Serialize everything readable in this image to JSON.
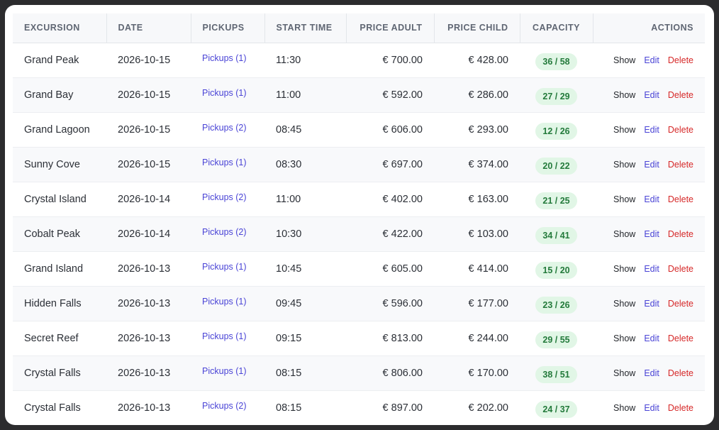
{
  "table": {
    "headers": [
      "Excursion",
      "Date",
      "Pickups",
      "Start Time",
      "Price Adult",
      "Price Child",
      "Capacity",
      "Actions"
    ],
    "action_labels": {
      "show": "Show",
      "edit": "Edit",
      "delete": "Delete"
    },
    "rows": [
      {
        "excursion": "Grand Peak",
        "date": "2026-10-15",
        "pickups": "Pickups (1)",
        "start": "11:30",
        "adult": "€ 700.00",
        "child": "€ 428.00",
        "capacity": "36 / 58"
      },
      {
        "excursion": "Grand Bay",
        "date": "2026-10-15",
        "pickups": "Pickups (1)",
        "start": "11:00",
        "adult": "€ 592.00",
        "child": "€ 286.00",
        "capacity": "27 / 29"
      },
      {
        "excursion": "Grand Lagoon",
        "date": "2026-10-15",
        "pickups": "Pickups (2)",
        "start": "08:45",
        "adult": "€ 606.00",
        "child": "€ 293.00",
        "capacity": "12 / 26"
      },
      {
        "excursion": "Sunny Cove",
        "date": "2026-10-15",
        "pickups": "Pickups (1)",
        "start": "08:30",
        "adult": "€ 697.00",
        "child": "€ 374.00",
        "capacity": "20 / 22"
      },
      {
        "excursion": "Crystal Island",
        "date": "2026-10-14",
        "pickups": "Pickups (2)",
        "start": "11:00",
        "adult": "€ 402.00",
        "child": "€ 163.00",
        "capacity": "21 / 25"
      },
      {
        "excursion": "Cobalt Peak",
        "date": "2026-10-14",
        "pickups": "Pickups (2)",
        "start": "10:30",
        "adult": "€ 422.00",
        "child": "€ 103.00",
        "capacity": "34 / 41"
      },
      {
        "excursion": "Grand Island",
        "date": "2026-10-13",
        "pickups": "Pickups (1)",
        "start": "10:45",
        "adult": "€ 605.00",
        "child": "€ 414.00",
        "capacity": "15 / 20"
      },
      {
        "excursion": "Hidden Falls",
        "date": "2026-10-13",
        "pickups": "Pickups (1)",
        "start": "09:45",
        "adult": "€ 596.00",
        "child": "€ 177.00",
        "capacity": "23 / 26"
      },
      {
        "excursion": "Secret Reef",
        "date": "2026-10-13",
        "pickups": "Pickups (1)",
        "start": "09:15",
        "adult": "€ 813.00",
        "child": "€ 244.00",
        "capacity": "29 / 55"
      },
      {
        "excursion": "Crystal Falls",
        "date": "2026-10-13",
        "pickups": "Pickups (1)",
        "start": "08:15",
        "adult": "€ 806.00",
        "child": "€ 170.00",
        "capacity": "38 / 51"
      },
      {
        "excursion": "Crystal Falls",
        "date": "2026-10-13",
        "pickups": "Pickups (2)",
        "start": "08:15",
        "adult": "€ 897.00",
        "child": "€ 202.00",
        "capacity": "24 / 37"
      }
    ]
  },
  "colors": {
    "link": "#4a44d6",
    "delete": "#d62828",
    "badge_bg": "#e1f6e6",
    "badge_text": "#237a3b"
  }
}
